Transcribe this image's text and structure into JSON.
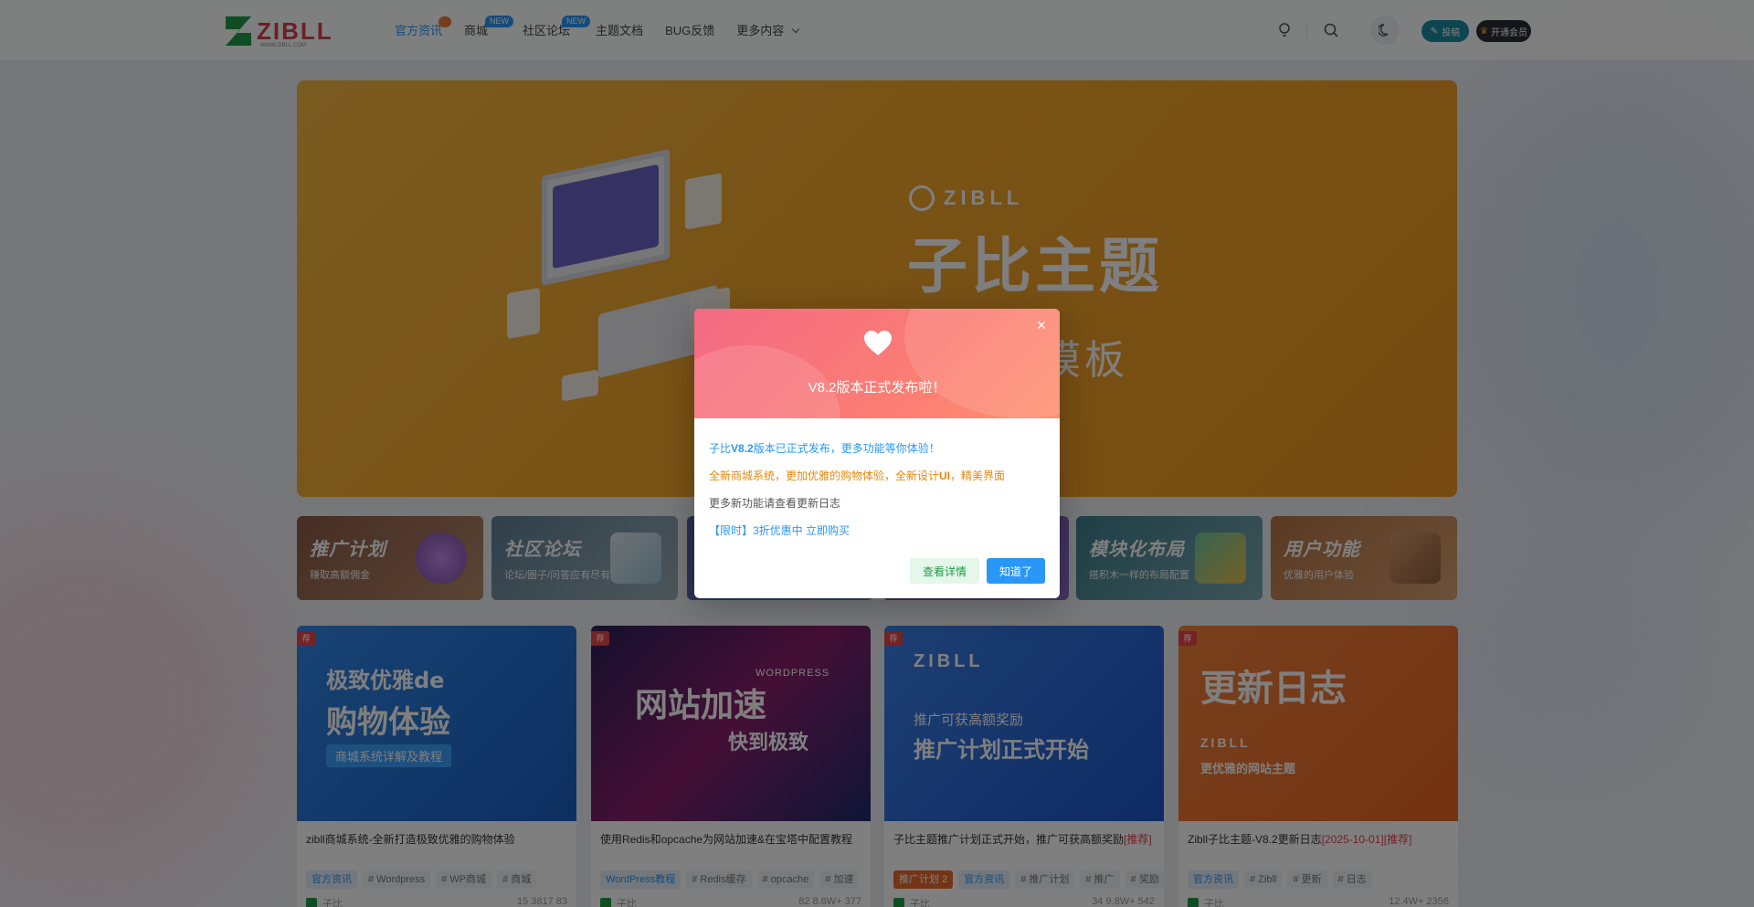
{
  "header": {
    "logo_text": "ZIBLL",
    "logo_sub": "WWW.ZIBLL.COM",
    "nav": [
      {
        "label": "官方资讯",
        "active": true,
        "badge": "dot"
      },
      {
        "label": "商城",
        "badge": "NEW"
      },
      {
        "label": "社区论坛",
        "badge": "NEW"
      },
      {
        "label": "主题文档"
      },
      {
        "label": "BUG反馈"
      },
      {
        "label": "更多内容",
        "dropdown": true
      }
    ],
    "post_button": "投稿",
    "vip_button": "开通会员",
    "icons": [
      "lightbulb-icon",
      "search-icon",
      "moon-icon"
    ]
  },
  "banner": {
    "logo_text": "ZIBLL",
    "title": "子比主题",
    "subtitle": "构建站模板"
  },
  "features": [
    {
      "title": "推广计划",
      "subtitle": "赚取高额佣金",
      "color": "#8a5a44"
    },
    {
      "title": "社区论坛",
      "subtitle": "论坛/圈子/问答应有尽有",
      "color": "#5a7d9a"
    },
    {
      "title": "",
      "subtitle": "",
      "color": "#4e5fa8"
    },
    {
      "title": "",
      "subtitle": "",
      "color": "#6a4fa0"
    },
    {
      "title": "模块化布局",
      "subtitle": "搭积木一样的布局配置",
      "color": "#3f7f8f"
    },
    {
      "title": "用户功能",
      "subtitle": "优雅的用户体验",
      "color": "#b57444"
    }
  ],
  "posts": [
    {
      "img_title_1": "极致优雅de",
      "img_title_2": "购物体验",
      "img_caption": "商城系统详解及教程",
      "corner": "荐",
      "title": "zibll商城系统-全新打造极致优雅的购物体验",
      "title_hl": "",
      "tags": [
        {
          "t": "官方资讯",
          "c": "blue"
        },
        {
          "t": "# Wordpress",
          "c": ""
        },
        {
          "t": "# WP商城",
          "c": ""
        },
        {
          "t": "# 商城",
          "c": ""
        }
      ],
      "author": "子比",
      "stats": "15  3817  83"
    },
    {
      "img_title_1": "网站加速",
      "img_title_2": "快到极致",
      "img_caption": "WORDPRESS",
      "corner": "荐",
      "title": "使用Redis和opcache为网站加速&在宝塔中配置教程",
      "title_hl": "",
      "tags": [
        {
          "t": "WordPress教程",
          "c": "blue"
        },
        {
          "t": "# Redis缓存",
          "c": ""
        },
        {
          "t": "# opcache",
          "c": ""
        },
        {
          "t": "# 加速",
          "c": ""
        }
      ],
      "author": "子比",
      "stats": "82  8.6W+  377"
    },
    {
      "img_title_1": "推广可获高额奖励",
      "img_title_2": "推广计划正式开始",
      "img_caption": "ZIBLL",
      "corner": "荐",
      "title": "子比主题推广计划正式开始，推广可获高额奖励",
      "title_hl": "[推荐]",
      "tags": [
        {
          "t": "推广计划 2",
          "c": "orange"
        },
        {
          "t": "官方资讯",
          "c": "blue"
        },
        {
          "t": "# 推广计划",
          "c": ""
        },
        {
          "t": "# 推广",
          "c": ""
        },
        {
          "t": "# 奖励",
          "c": ""
        }
      ],
      "author": "子比",
      "stats": "34  9.8W+  542"
    },
    {
      "img_title_1": "更新日志",
      "img_title_2": "更优雅的网站主题",
      "img_caption": "ZIBLL",
      "corner": "荐",
      "title": "Zibll子比主题-V8.2更新日志",
      "title_hl": "[2025-10-01][推荐]",
      "tags": [
        {
          "t": "官方资讯",
          "c": "blue"
        },
        {
          "t": "# Zibll",
          "c": ""
        },
        {
          "t": "# 更新",
          "c": ""
        },
        {
          "t": "# 日志",
          "c": ""
        }
      ],
      "author": "子比",
      "stats": "12.4W+  2356"
    }
  ],
  "modal": {
    "title": "V8.2版本正式发布啦！",
    "line1_pre": "子比",
    "line1_bold": "V8.2",
    "line1_post": "版本已正式发布，更多功能等你体验！",
    "line2_pre": "全新商城系统，更加优雅的购物体验，全新设计",
    "line2_bold": "UI",
    "line2_post": "，精美界面",
    "line3": "更多新功能请查看更新日志",
    "line4": "【限时】3折优惠中 立即购买",
    "btn_secondary": "查看详情",
    "btn_primary": "知道了",
    "close": "×"
  }
}
